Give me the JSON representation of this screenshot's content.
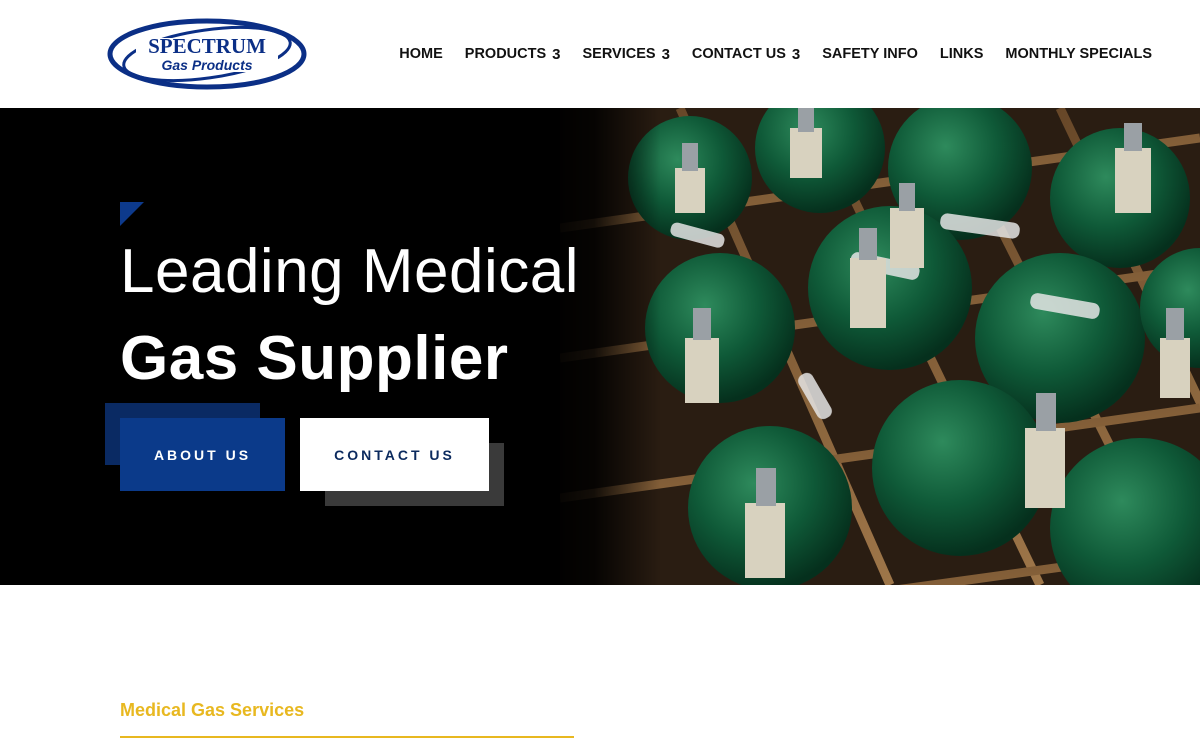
{
  "brand": {
    "logo_line1": "SPECTRUM",
    "logo_line2": "Gas Products",
    "logo_color": "#0b2f86"
  },
  "nav": {
    "items": [
      {
        "label": "HOME",
        "has_dropdown": false
      },
      {
        "label": "PRODUCTS",
        "has_dropdown": true,
        "caret": "3"
      },
      {
        "label": "SERVICES",
        "has_dropdown": true,
        "caret": "3"
      },
      {
        "label": "CONTACT US",
        "has_dropdown": true,
        "caret": "3"
      },
      {
        "label": "SAFETY INFO",
        "has_dropdown": false
      },
      {
        "label": "LINKS",
        "has_dropdown": false
      },
      {
        "label": "MONTHLY SPECIALS",
        "has_dropdown": false
      }
    ]
  },
  "hero": {
    "line1": "Leading Medical",
    "line2": "Gas Supplier",
    "about_button": "ABOUT US",
    "contact_button": "CONTACT US",
    "background": "#000000",
    "accent_color": "#0b3a8a",
    "image_icon": "medical-oxygen-cylinders-photo"
  },
  "section": {
    "title": "Medical Gas Services",
    "accent_color": "#e8b820"
  }
}
